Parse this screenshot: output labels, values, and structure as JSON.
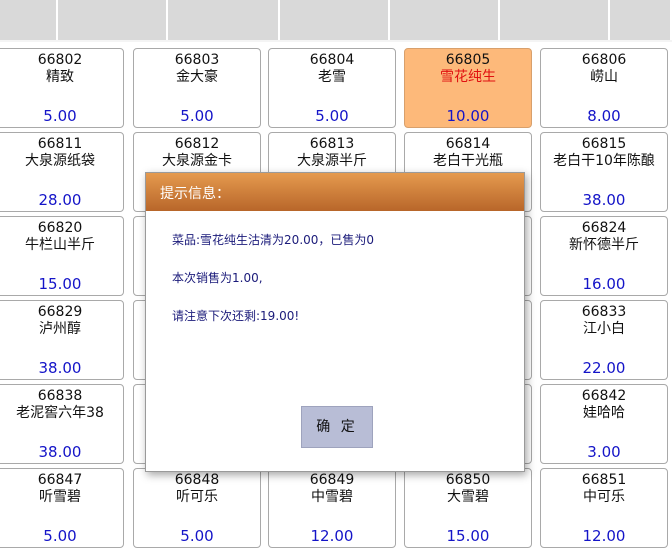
{
  "colors": {
    "price": "#1414c8",
    "selected_tile_bg": "#fdb97a",
    "selected_name": "#e01010",
    "dialog_header": "#c8742f",
    "dialog_text": "#1b1b7a",
    "button_bg": "#b8bdd6"
  },
  "top_tabs": [
    "",
    "",
    "",
    "",
    "",
    ""
  ],
  "rows": [
    [
      {
        "code": "66802",
        "name": "精致",
        "price": "5.00"
      },
      {
        "code": "66803",
        "name": "金大豪",
        "price": "5.00"
      },
      {
        "code": "66804",
        "name": "老雪",
        "price": "5.00"
      },
      {
        "code": "66805",
        "name": "雪花纯生",
        "price": "10.00",
        "selected": true
      },
      {
        "code": "66806",
        "name": "崂山",
        "price": "8.00"
      }
    ],
    [
      {
        "code": "66811",
        "name": "大泉源纸袋",
        "price": "28.00"
      },
      {
        "code": "66812",
        "name": "大泉源金卡",
        "price": ""
      },
      {
        "code": "66813",
        "name": "大泉源半斤",
        "price": ""
      },
      {
        "code": "66814",
        "name": "老白干光瓶",
        "price": ""
      },
      {
        "code": "66815",
        "name": "老白干10年陈酿",
        "price": "38.00"
      }
    ],
    [
      {
        "code": "66820",
        "name": "牛栏山半斤",
        "price": "15.00"
      },
      {
        "code": "",
        "name": "",
        "price": ""
      },
      {
        "code": "",
        "name": "",
        "price": ""
      },
      {
        "code": "",
        "name": "",
        "price": ""
      },
      {
        "code": "66824",
        "name": "新怀德半斤",
        "price": "16.00"
      }
    ],
    [
      {
        "code": "66829",
        "name": "泸州醇",
        "price": "38.00"
      },
      {
        "code": "",
        "name": "",
        "price": ""
      },
      {
        "code": "",
        "name": "",
        "price": ""
      },
      {
        "code": "",
        "name": "",
        "price": ""
      },
      {
        "code": "66833",
        "name": "江小白",
        "price": "22.00"
      }
    ],
    [
      {
        "code": "66838",
        "name": "老泥窖六年38",
        "price": "38.00"
      },
      {
        "code": "",
        "name": "",
        "price": ""
      },
      {
        "code": "",
        "name": "",
        "price": ""
      },
      {
        "code": "",
        "name": "",
        "price": ""
      },
      {
        "code": "66842",
        "name": "娃哈哈",
        "price": "3.00"
      }
    ],
    [
      {
        "code": "66847",
        "name": "听雪碧",
        "price": "5.00"
      },
      {
        "code": "66848",
        "name": "听可乐",
        "price": "5.00"
      },
      {
        "code": "66849",
        "name": "中雪碧",
        "price": "12.00"
      },
      {
        "code": "66850",
        "name": "大雪碧",
        "price": "15.00"
      },
      {
        "code": "66851",
        "name": "中可乐",
        "price": "12.00"
      }
    ]
  ],
  "dialog": {
    "title": "提示信息：",
    "messages": [
      "菜品:雪花纯生沽清为20.00，已售为0",
      "本次销售为1.00,",
      "请注意下次还剩:19.00!"
    ],
    "ok_label": "确 定"
  }
}
